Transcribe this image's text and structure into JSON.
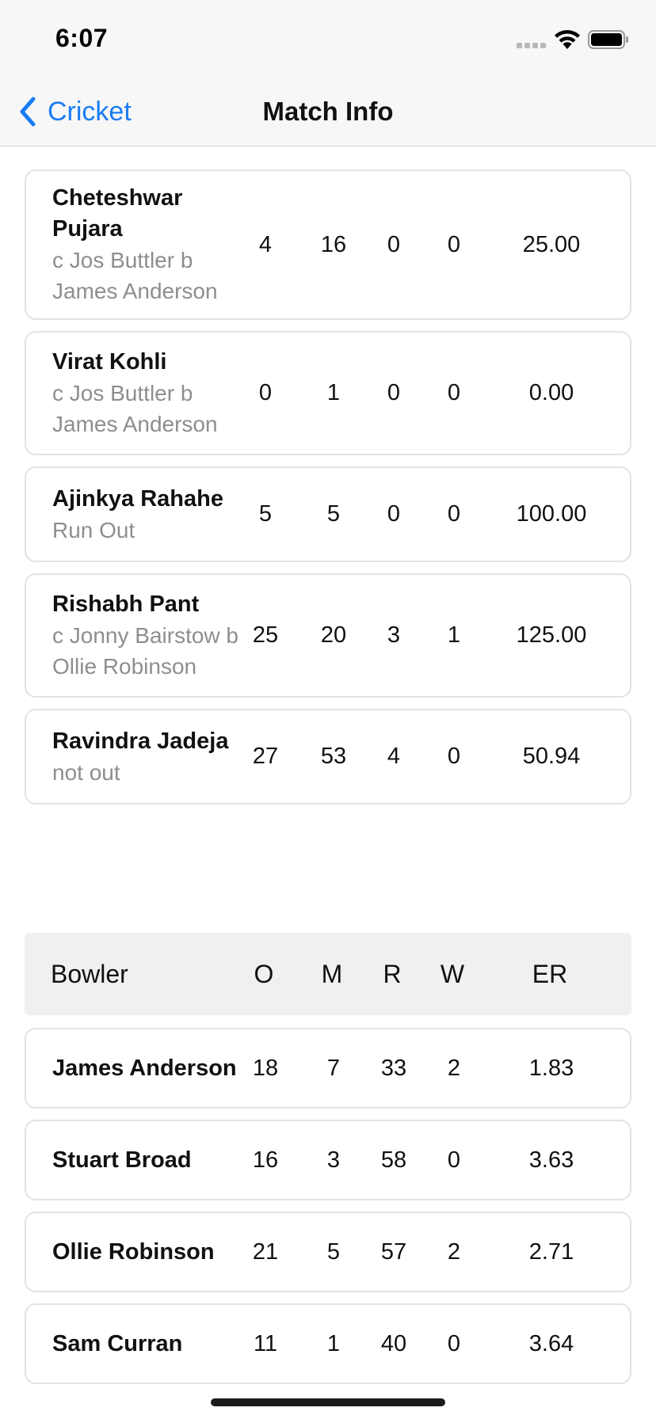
{
  "status_bar": {
    "time": "6:07"
  },
  "nav": {
    "back_label": "Cricket",
    "title": "Match Info"
  },
  "batters": [
    {
      "name": "Cheteshwar Pujara",
      "dismissal": "c Jos Buttler b James Anderson",
      "r": "4",
      "b": "16",
      "fours": "0",
      "sixes": "0",
      "sr": "25.00"
    },
    {
      "name": "Virat Kohli",
      "dismissal": "c Jos Buttler b James Anderson",
      "r": "0",
      "b": "1",
      "fours": "0",
      "sixes": "0",
      "sr": "0.00"
    },
    {
      "name": "Ajinkya Rahahe",
      "dismissal": "Run Out",
      "r": "5",
      "b": "5",
      "fours": "0",
      "sixes": "0",
      "sr": "100.00"
    },
    {
      "name": "Rishabh Pant",
      "dismissal": "c Jonny Bairstow b Ollie Robinson",
      "r": "25",
      "b": "20",
      "fours": "3",
      "sixes": "1",
      "sr": "125.00"
    },
    {
      "name": "Ravindra Jadeja",
      "dismissal": "not out",
      "r": "27",
      "b": "53",
      "fours": "4",
      "sixes": "0",
      "sr": "50.94"
    }
  ],
  "bowling_header": {
    "name": "Bowler",
    "o": "O",
    "m": "M",
    "r": "R",
    "w": "W",
    "er": "ER"
  },
  "bowlers": [
    {
      "name": "James Anderson",
      "o": "18",
      "m": "7",
      "r": "33",
      "w": "2",
      "er": "1.83"
    },
    {
      "name": "Stuart Broad",
      "o": "16",
      "m": "3",
      "r": "58",
      "w": "0",
      "er": "3.63"
    },
    {
      "name": "Ollie Robinson",
      "o": "21",
      "m": "5",
      "r": "57",
      "w": "2",
      "er": "2.71"
    },
    {
      "name": "Sam Curran",
      "o": "11",
      "m": "1",
      "r": "40",
      "w": "0",
      "er": "3.64"
    }
  ],
  "colors": {
    "accent": "#1a7cf5",
    "secondary_text": "#8e8e8e",
    "card_border": "#e3e3e3",
    "header_bg": "#f0f0f0"
  }
}
